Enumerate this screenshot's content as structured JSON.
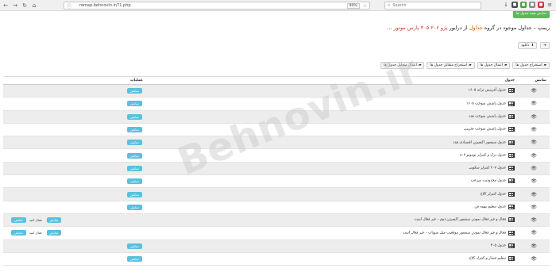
{
  "browser": {
    "url": "remap.behnovin.ir/?1.php",
    "zoom": "90%",
    "search_placeholder": "Search"
  },
  "page": {
    "top_button": "نمایش همه جدول ها",
    "title_prefix": "ریمپ – جداول موجود در گروه",
    "title_group": "جداول",
    "title_mid": "از درایور",
    "title_highlight": "پژو ۲۰۶ ۴۰۵ پارس موتور",
    "title_suffix": "..."
  },
  "toolbar1": {
    "back_label": "",
    "download_label": "دانلود"
  },
  "toolbar2": [
    {
      "label": "استخراج جدول ها"
    },
    {
      "label": "اعمال جدول ها"
    },
    {
      "label": "استخراج متقابل جدول ها"
    },
    {
      "label": "اعمال متقابل جدول ها"
    }
  ],
  "table": {
    "headers": {
      "view": "نمایش",
      "table": "جدول",
      "ops": "عملیات"
    },
    "rows": [
      {
        "name": "جدول آفرینش ترانه ۱۶۰۵",
        "warn": "",
        "button": "نمایش",
        "status": ""
      },
      {
        "name": "جدول پاشش سوخت ۱۶۰۵",
        "warn": "",
        "button": "نمایش",
        "status": ""
      },
      {
        "name": "جدول پاشش سوخت هدد",
        "warn": "",
        "button": "نمایش",
        "status": ""
      },
      {
        "name": "جدول پاشش سوخت تخریبی",
        "warn": "",
        "button": "نمایش",
        "status": ""
      },
      {
        "name": "جدول سنسور اکسیژن اقتصادی هدد",
        "warn": "",
        "button": "نمایش",
        "status": ""
      },
      {
        "name": "جدول ترک و کنترلر توموبو ۸۰۲",
        "warn": "",
        "button": "نمایش",
        "status": ""
      },
      {
        "name": "جدول ۳۰۷ کنترلر سکوپی",
        "warn": "",
        "button": "نمایش",
        "status": ""
      },
      {
        "name": "جدول محدودیت سرعت",
        "warn": "",
        "button": "نمایش",
        "status": ""
      },
      {
        "name": "جدول کنترلر کلاچ",
        "warn": "",
        "button": "نمایش",
        "status": ""
      },
      {
        "name": "جدول تنظیم بهینه فن",
        "warn": "",
        "button": "نمایش",
        "status": ""
      },
      {
        "name": "فعال و غیر فعال نمودن سنسور اکسیژن دوم –",
        "warn": "غیر فعال است",
        "button": "نمایش",
        "status": "فعال کنید"
      },
      {
        "name": "فعال و غیر فعال نمودن سنسور موقعیت میل سوپاپ –",
        "warn": "غیر فعال است",
        "button": "نمایش",
        "status": "فعال کنید"
      },
      {
        "name": "جدول ۴۰۵",
        "warn": "",
        "button": "نمایش",
        "status": ""
      },
      {
        "name": "تنظیم فشار و کنترل کلاچ",
        "warn": "",
        "button": "نمایش",
        "status": ""
      }
    ]
  },
  "watermark": "Behnovin.ir"
}
